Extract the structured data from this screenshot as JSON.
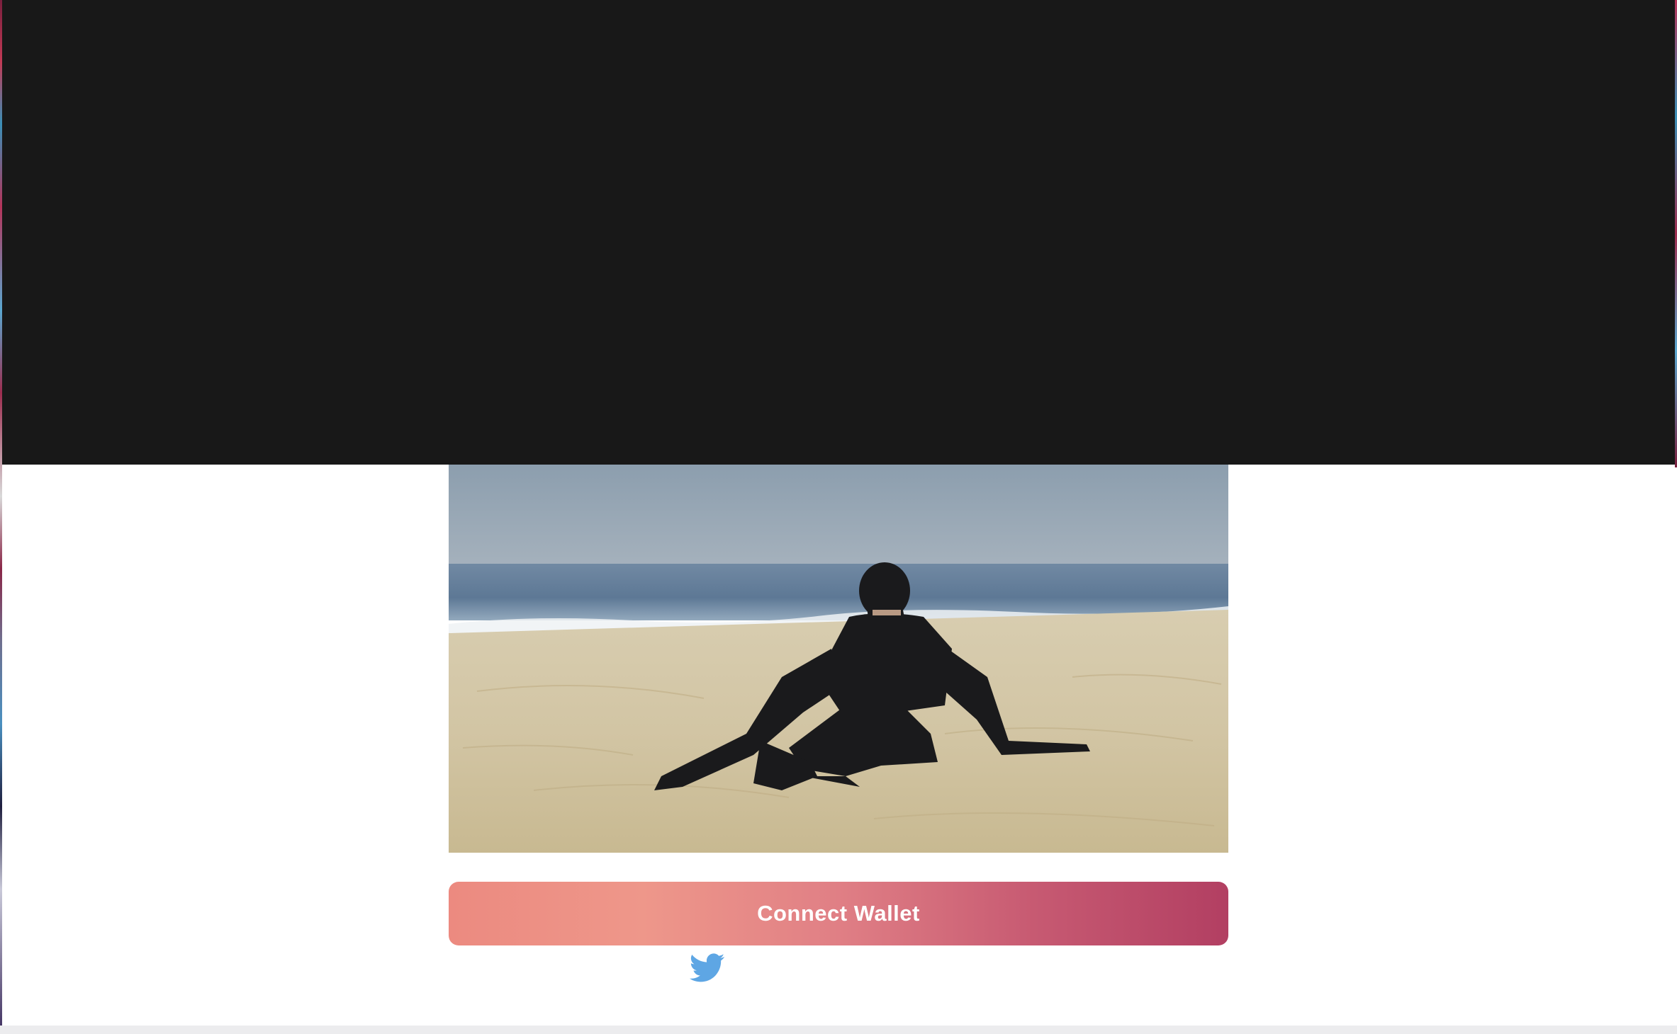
{
  "page": {
    "banner_color": "#181818",
    "background_color": "#ffffff"
  },
  "hero": {
    "image_icon": "ninja-on-beach-image"
  },
  "wallet": {
    "connect_label": "Connect Wallet",
    "gradient_start": "#ec8a80",
    "gradient_end": "#b23f62"
  },
  "social": {
    "twitter_icon": "twitter-icon",
    "twitter_color": "#5ea6e4"
  }
}
